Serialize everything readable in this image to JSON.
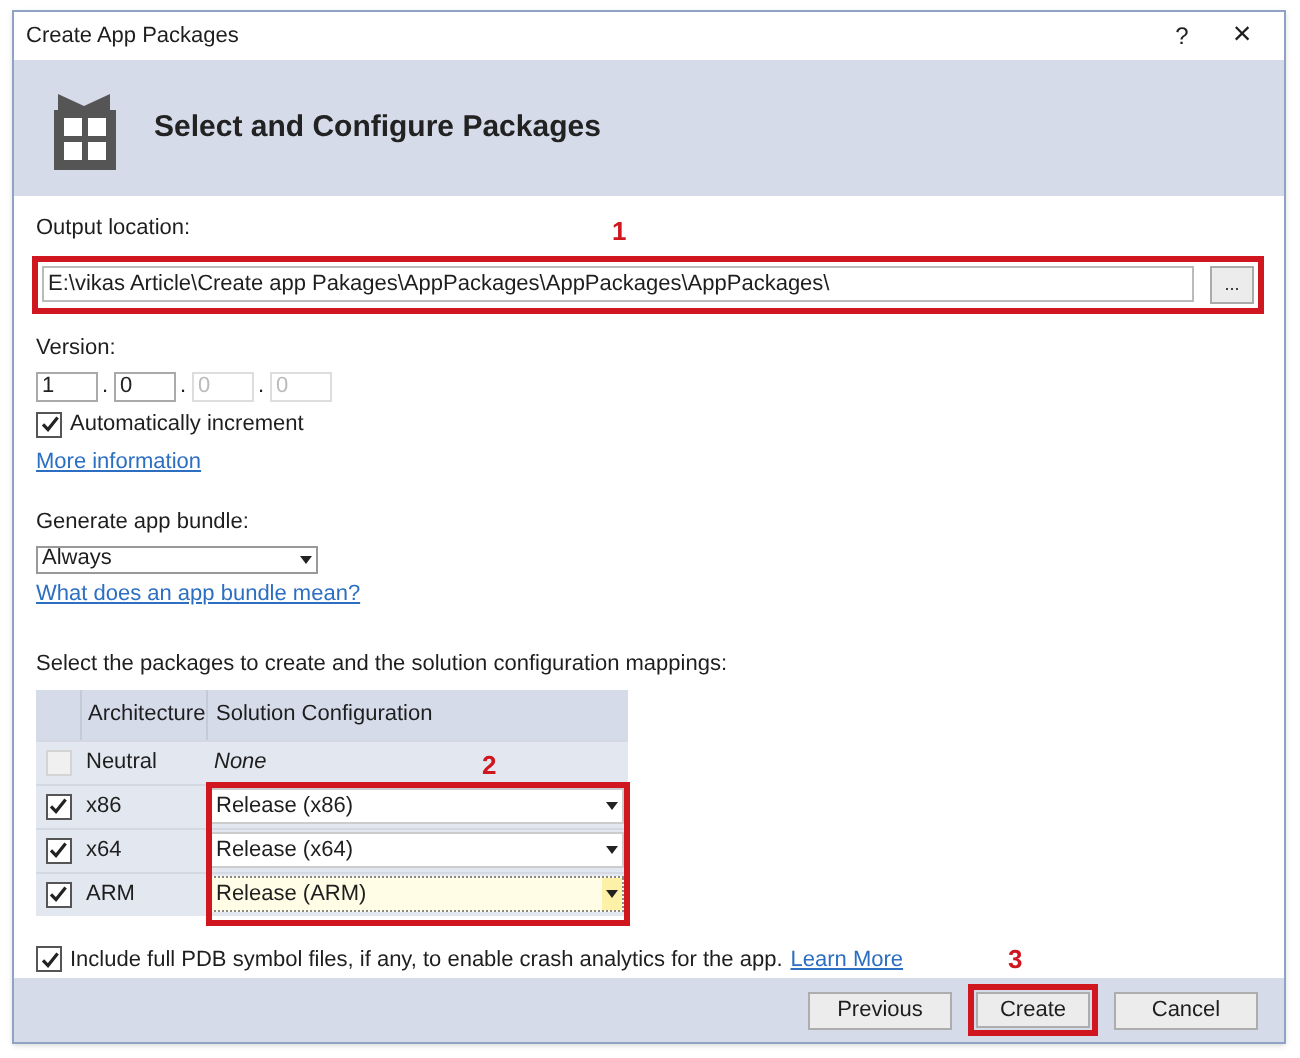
{
  "window": {
    "title": "Create App Packages",
    "help": "?",
    "close": "×"
  },
  "header": {
    "title": "Select and Configure Packages"
  },
  "output_location": {
    "label": "Output location:",
    "value": "E:\\vikas Article\\Create app Pakages\\AppPackages\\AppPackages\\AppPackages\\",
    "browse": "...",
    "annotation": "1"
  },
  "version": {
    "label": "Version:",
    "parts": [
      {
        "value": "1",
        "disabled": false
      },
      {
        "value": "0",
        "disabled": false
      },
      {
        "value": "0",
        "disabled": true
      },
      {
        "value": "0",
        "disabled": true
      }
    ],
    "separator": "."
  },
  "auto_increment": {
    "label": "Automatically increment",
    "checked": true
  },
  "more_info_link": "More information",
  "bundle": {
    "label": "Generate app bundle:",
    "value": "Always",
    "link": "What does an app bundle mean?"
  },
  "packages": {
    "label": "Select the packages to create and the solution configuration mappings:",
    "annotation": "2",
    "columns": [
      "Architecture",
      "Solution Configuration"
    ],
    "rows": [
      {
        "checked": false,
        "disabled": true,
        "architecture": "Neutral",
        "config": "None",
        "kind": "text"
      },
      {
        "checked": true,
        "disabled": false,
        "architecture": "x86",
        "config": "Release (x86)",
        "kind": "dropdown",
        "focused": false
      },
      {
        "checked": true,
        "disabled": false,
        "architecture": "x64",
        "config": "Release (x64)",
        "kind": "dropdown",
        "focused": false
      },
      {
        "checked": true,
        "disabled": false,
        "architecture": "ARM",
        "config": "Release (ARM)",
        "kind": "dropdown",
        "focused": true
      }
    ]
  },
  "pdb": {
    "checked": true,
    "label": "Include full PDB symbol files, if any, to enable crash analytics for the app.",
    "link": "Learn More"
  },
  "buttons": [
    {
      "label": "Previous"
    },
    {
      "label": "Create",
      "annotation": "3"
    },
    {
      "label": "Cancel"
    }
  ]
}
